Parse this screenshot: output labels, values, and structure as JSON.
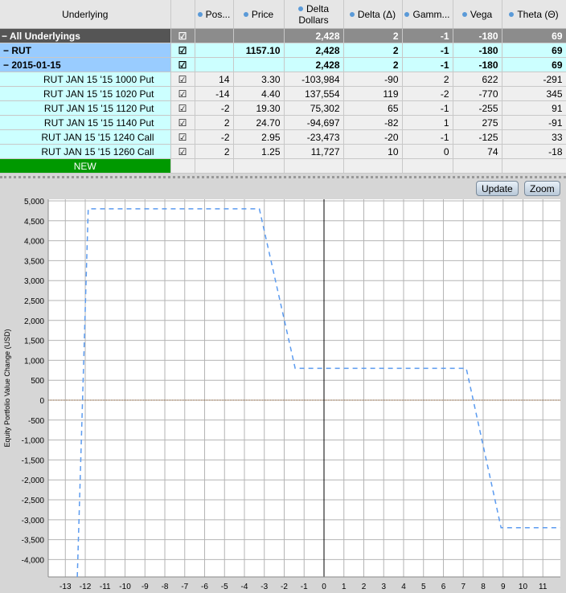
{
  "columns": [
    "Underlying",
    "",
    "Pos...",
    "Price",
    "Delta Dollars",
    "Delta (Δ)",
    "Gamm...",
    "Vega",
    "Theta (Θ)"
  ],
  "rows": [
    {
      "kind": "all",
      "name": "− All Underlyings",
      "checked": "☑",
      "pos": "",
      "price": "",
      "dd": "2,428",
      "delta": "2",
      "gamma": "-1",
      "vega": "-180",
      "theta": "69"
    },
    {
      "kind": "rut",
      "name": "− RUT",
      "checked": "☑",
      "pos": "",
      "price": "1157.10",
      "dd": "2,428",
      "delta": "2",
      "gamma": "-1",
      "vega": "-180",
      "theta": "69"
    },
    {
      "kind": "exp",
      "name": "− 2015-01-15",
      "checked": "☑",
      "pos": "",
      "price": "",
      "dd": "2,428",
      "delta": "2",
      "gamma": "-1",
      "vega": "-180",
      "theta": "69"
    },
    {
      "kind": "leg",
      "name": "RUT JAN 15 '15 1000 Put",
      "checked": "☑",
      "pos": "14",
      "price": "3.30",
      "dd": "-103,984",
      "delta": "-90",
      "gamma": "2",
      "vega": "622",
      "theta": "-291"
    },
    {
      "kind": "leg",
      "name": "RUT JAN 15 '15 1020 Put",
      "checked": "☑",
      "pos": "-14",
      "price": "4.40",
      "dd": "137,554",
      "delta": "119",
      "gamma": "-2",
      "vega": "-770",
      "theta": "345"
    },
    {
      "kind": "leg",
      "name": "RUT JAN 15 '15 1120 Put",
      "checked": "☑",
      "pos": "-2",
      "price": "19.30",
      "dd": "75,302",
      "delta": "65",
      "gamma": "-1",
      "vega": "-255",
      "theta": "91"
    },
    {
      "kind": "leg",
      "name": "RUT JAN 15 '15 1140 Put",
      "checked": "☑",
      "pos": "2",
      "price": "24.70",
      "dd": "-94,697",
      "delta": "-82",
      "gamma": "1",
      "vega": "275",
      "theta": "-91"
    },
    {
      "kind": "leg",
      "name": "RUT JAN 15 '15 1240 Call",
      "checked": "☑",
      "pos": "-2",
      "price": "2.95",
      "dd": "-23,473",
      "delta": "-20",
      "gamma": "-1",
      "vega": "-125",
      "theta": "33"
    },
    {
      "kind": "leg",
      "name": "RUT JAN 15 '15 1260 Call",
      "checked": "☑",
      "pos": "2",
      "price": "1.25",
      "dd": "11,727",
      "delta": "10",
      "gamma": "0",
      "vega": "74",
      "theta": "-18"
    }
  ],
  "new_label": "NEW",
  "buttons": {
    "update": "Update",
    "zoom": "Zoom"
  },
  "chart_data": {
    "type": "line",
    "ylabel": "Equity Portfolio Value Change (USD)",
    "xlabel": "",
    "xlim": [
      -13.86,
      11.88
    ],
    "ylim": [
      -4435,
      5040
    ],
    "xticks": [
      -13,
      -12,
      -11,
      -10,
      -9,
      -8,
      -7,
      -6,
      -5,
      -4,
      -3,
      -2,
      -1,
      0,
      1,
      2,
      3,
      4,
      5,
      6,
      7,
      8,
      9,
      10,
      11
    ],
    "yticks": [
      5000,
      4500,
      4000,
      3500,
      3000,
      2500,
      2000,
      1500,
      1000,
      500,
      0,
      -500,
      -1000,
      -1500,
      -2000,
      -2500,
      -3000,
      -3500,
      -4000
    ],
    "grid": true,
    "series": [
      {
        "color": "#5b9bf0",
        "style": "dashed",
        "x": [
          -12.4,
          -11.85,
          -3.25,
          -1.45,
          7.15,
          8.9,
          11.88
        ],
        "y": [
          -4435,
          4800,
          4800,
          800,
          800,
          -3200,
          -3200
        ]
      }
    ]
  }
}
